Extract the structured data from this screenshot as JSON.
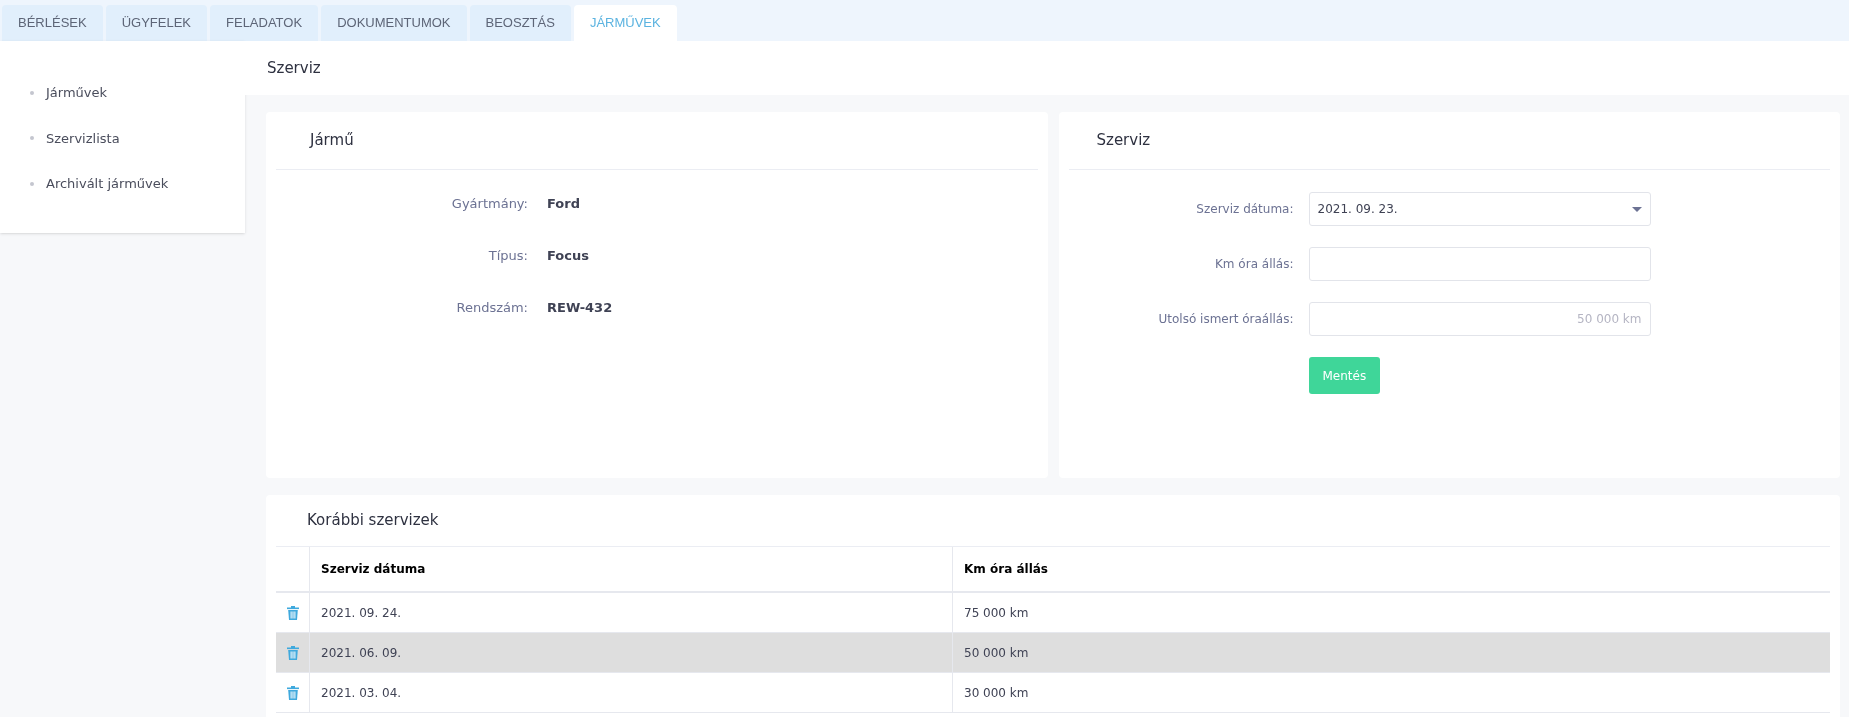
{
  "tabs": [
    {
      "label": "BÉRLÉSEK",
      "selected": false
    },
    {
      "label": "ÜGYFELEK",
      "selected": false
    },
    {
      "label": "FELADATOK",
      "selected": false
    },
    {
      "label": "DOKUMENTUMOK",
      "selected": false
    },
    {
      "label": "BEOSZTÁS",
      "selected": false
    },
    {
      "label": "JÁRMŰVEK",
      "selected": true
    }
  ],
  "sidebar": {
    "items": [
      "Járművek",
      "Szervizlista",
      "Archivált járművek"
    ]
  },
  "page_title": "Szerviz",
  "vehicle_card": {
    "title": "Jármű",
    "fields": [
      {
        "label": "Gyártmány:",
        "value": "Ford"
      },
      {
        "label": "Típus:",
        "value": "Focus"
      },
      {
        "label": "Rendszám:",
        "value": "REW-432"
      }
    ]
  },
  "service_card": {
    "title": "Szerviz",
    "fields": [
      {
        "kind": "select",
        "label": "Szerviz dátuma:",
        "value": "2021. 09. 23."
      },
      {
        "kind": "input",
        "label": "Km óra állás:"
      },
      {
        "kind": "input",
        "label": "Utolsó ismert óraállás:",
        "placeholder": "50 000 km"
      }
    ],
    "button": "Mentés"
  },
  "history": {
    "title": "Korábbi szervizek",
    "columns": [
      "Szerviz dátuma",
      "Km óra állás"
    ],
    "rows": [
      {
        "cells": [
          "2021. 09. 24.",
          "75 000 km"
        ],
        "selected": false
      },
      {
        "cells": [
          "2021. 06. 09.",
          "50 000 km"
        ],
        "selected": true
      },
      {
        "cells": [
          "2021. 03. 04.",
          "30 000 km"
        ],
        "selected": false
      }
    ]
  }
}
